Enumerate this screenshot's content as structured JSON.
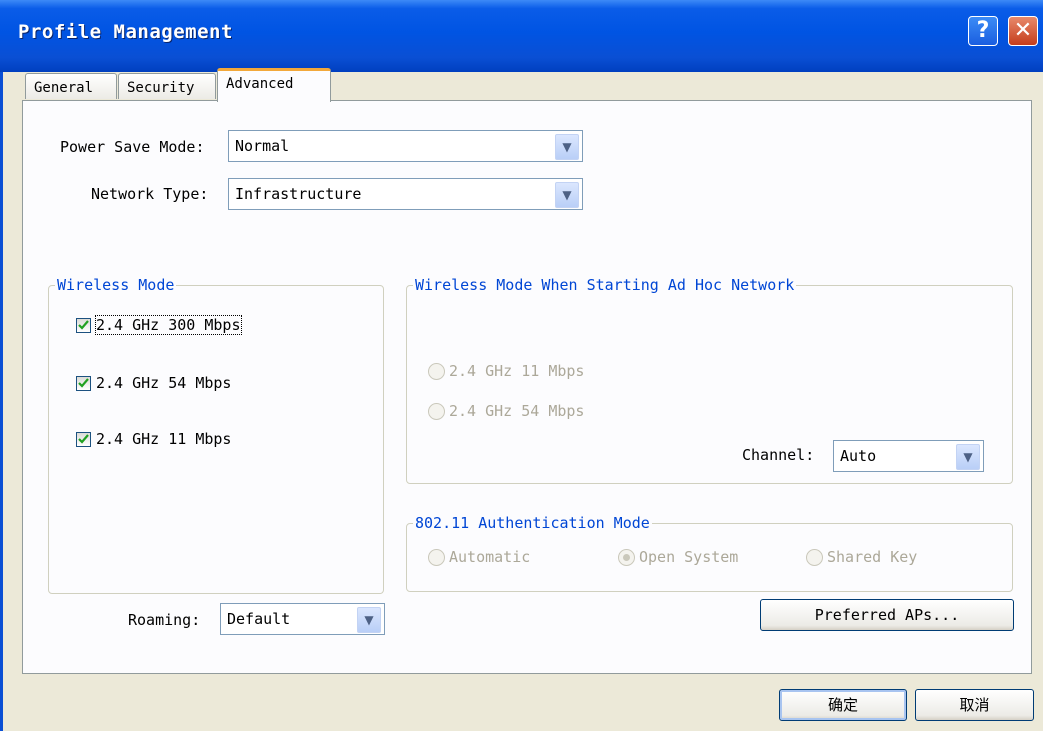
{
  "window": {
    "title": "Profile Management",
    "help_label": "?",
    "close_label": "✕"
  },
  "tabs": [
    {
      "label": "General",
      "active": false
    },
    {
      "label": "Security",
      "active": false
    },
    {
      "label": "Advanced",
      "active": true
    }
  ],
  "power_save": {
    "label": "Power Save Mode:",
    "value": "Normal"
  },
  "network_type": {
    "label": "Network Type:",
    "value": "Infrastructure"
  },
  "wireless_mode": {
    "legend": "Wireless Mode",
    "options": [
      {
        "label": "2.4 GHz 300 Mbps",
        "checked": true
      },
      {
        "label": "2.4 GHz 54 Mbps",
        "checked": true
      },
      {
        "label": "2.4 GHz 11 Mbps",
        "checked": true
      }
    ]
  },
  "adhoc": {
    "legend": "Wireless Mode When Starting Ad Hoc Network",
    "options": [
      {
        "label": "2.4 GHz 11 Mbps",
        "selected": false
      },
      {
        "label": "2.4 GHz 54 Mbps",
        "selected": false
      }
    ],
    "channel_label": "Channel:",
    "channel_value": "Auto"
  },
  "auth": {
    "legend": "802.11 Authentication Mode",
    "options": [
      {
        "label": "Automatic",
        "selected": false
      },
      {
        "label": "Open System",
        "selected": true
      },
      {
        "label": "Shared Key",
        "selected": false
      }
    ]
  },
  "roaming": {
    "label": "Roaming:",
    "value": "Default"
  },
  "buttons": {
    "preferred_aps": "Preferred APs...",
    "ok": "确定",
    "cancel": "取消"
  },
  "icons": {
    "dropdown_arrow": "chevron-down-icon",
    "check": "checkmark-icon"
  },
  "colors": {
    "title_bar": "#0054e3",
    "group_legend": "#0046d5",
    "active_tab_accent": "#f2a83a",
    "checkmark": "#21a121",
    "disabled_text": "#aca899"
  }
}
